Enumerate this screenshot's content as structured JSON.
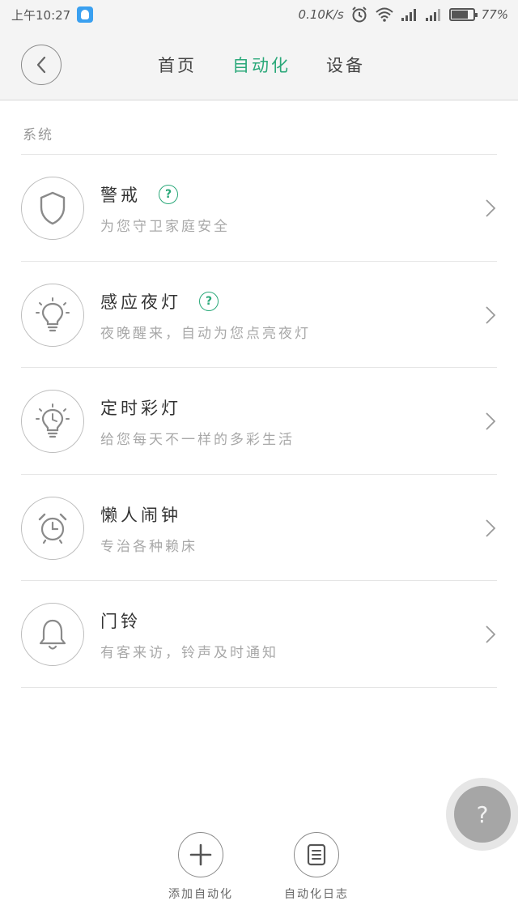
{
  "status_bar": {
    "time": "上午10:27",
    "network_speed": "0.10K/s",
    "battery_percent": "77%",
    "battery_level": 0.77,
    "icons": [
      "qq-icon",
      "alarm-icon",
      "wifi-icon",
      "signal-icon",
      "signal-icon",
      "battery-icon"
    ]
  },
  "header": {
    "tabs": [
      {
        "label": "首页",
        "active": false
      },
      {
        "label": "自动化",
        "active": true
      },
      {
        "label": "设备",
        "active": false
      }
    ],
    "accent_color": "#2aa879"
  },
  "section": {
    "title": "系统"
  },
  "items": [
    {
      "title": "警戒",
      "subtitle": "为您守卫家庭安全",
      "icon": "shield-icon",
      "has_help": true,
      "help_symbol": "?"
    },
    {
      "title": "感应夜灯",
      "subtitle": "夜晚醒来，自动为您点亮夜灯",
      "icon": "bulb-icon",
      "has_help": true,
      "help_symbol": "?"
    },
    {
      "title": "定时彩灯",
      "subtitle": "给您每天不一样的多彩生活",
      "icon": "timer-bulb-icon",
      "has_help": false
    },
    {
      "title": "懒人闹钟",
      "subtitle": "专治各种赖床",
      "icon": "alarm-clock-icon",
      "has_help": false
    },
    {
      "title": "门铃",
      "subtitle": "有客来访，铃声及时通知",
      "icon": "bell-icon",
      "has_help": false
    }
  ],
  "fab": {
    "symbol": "?"
  },
  "bottom_actions": [
    {
      "label": "添加自动化",
      "icon": "plus-icon"
    },
    {
      "label": "自动化日志",
      "icon": "document-icon"
    }
  ]
}
